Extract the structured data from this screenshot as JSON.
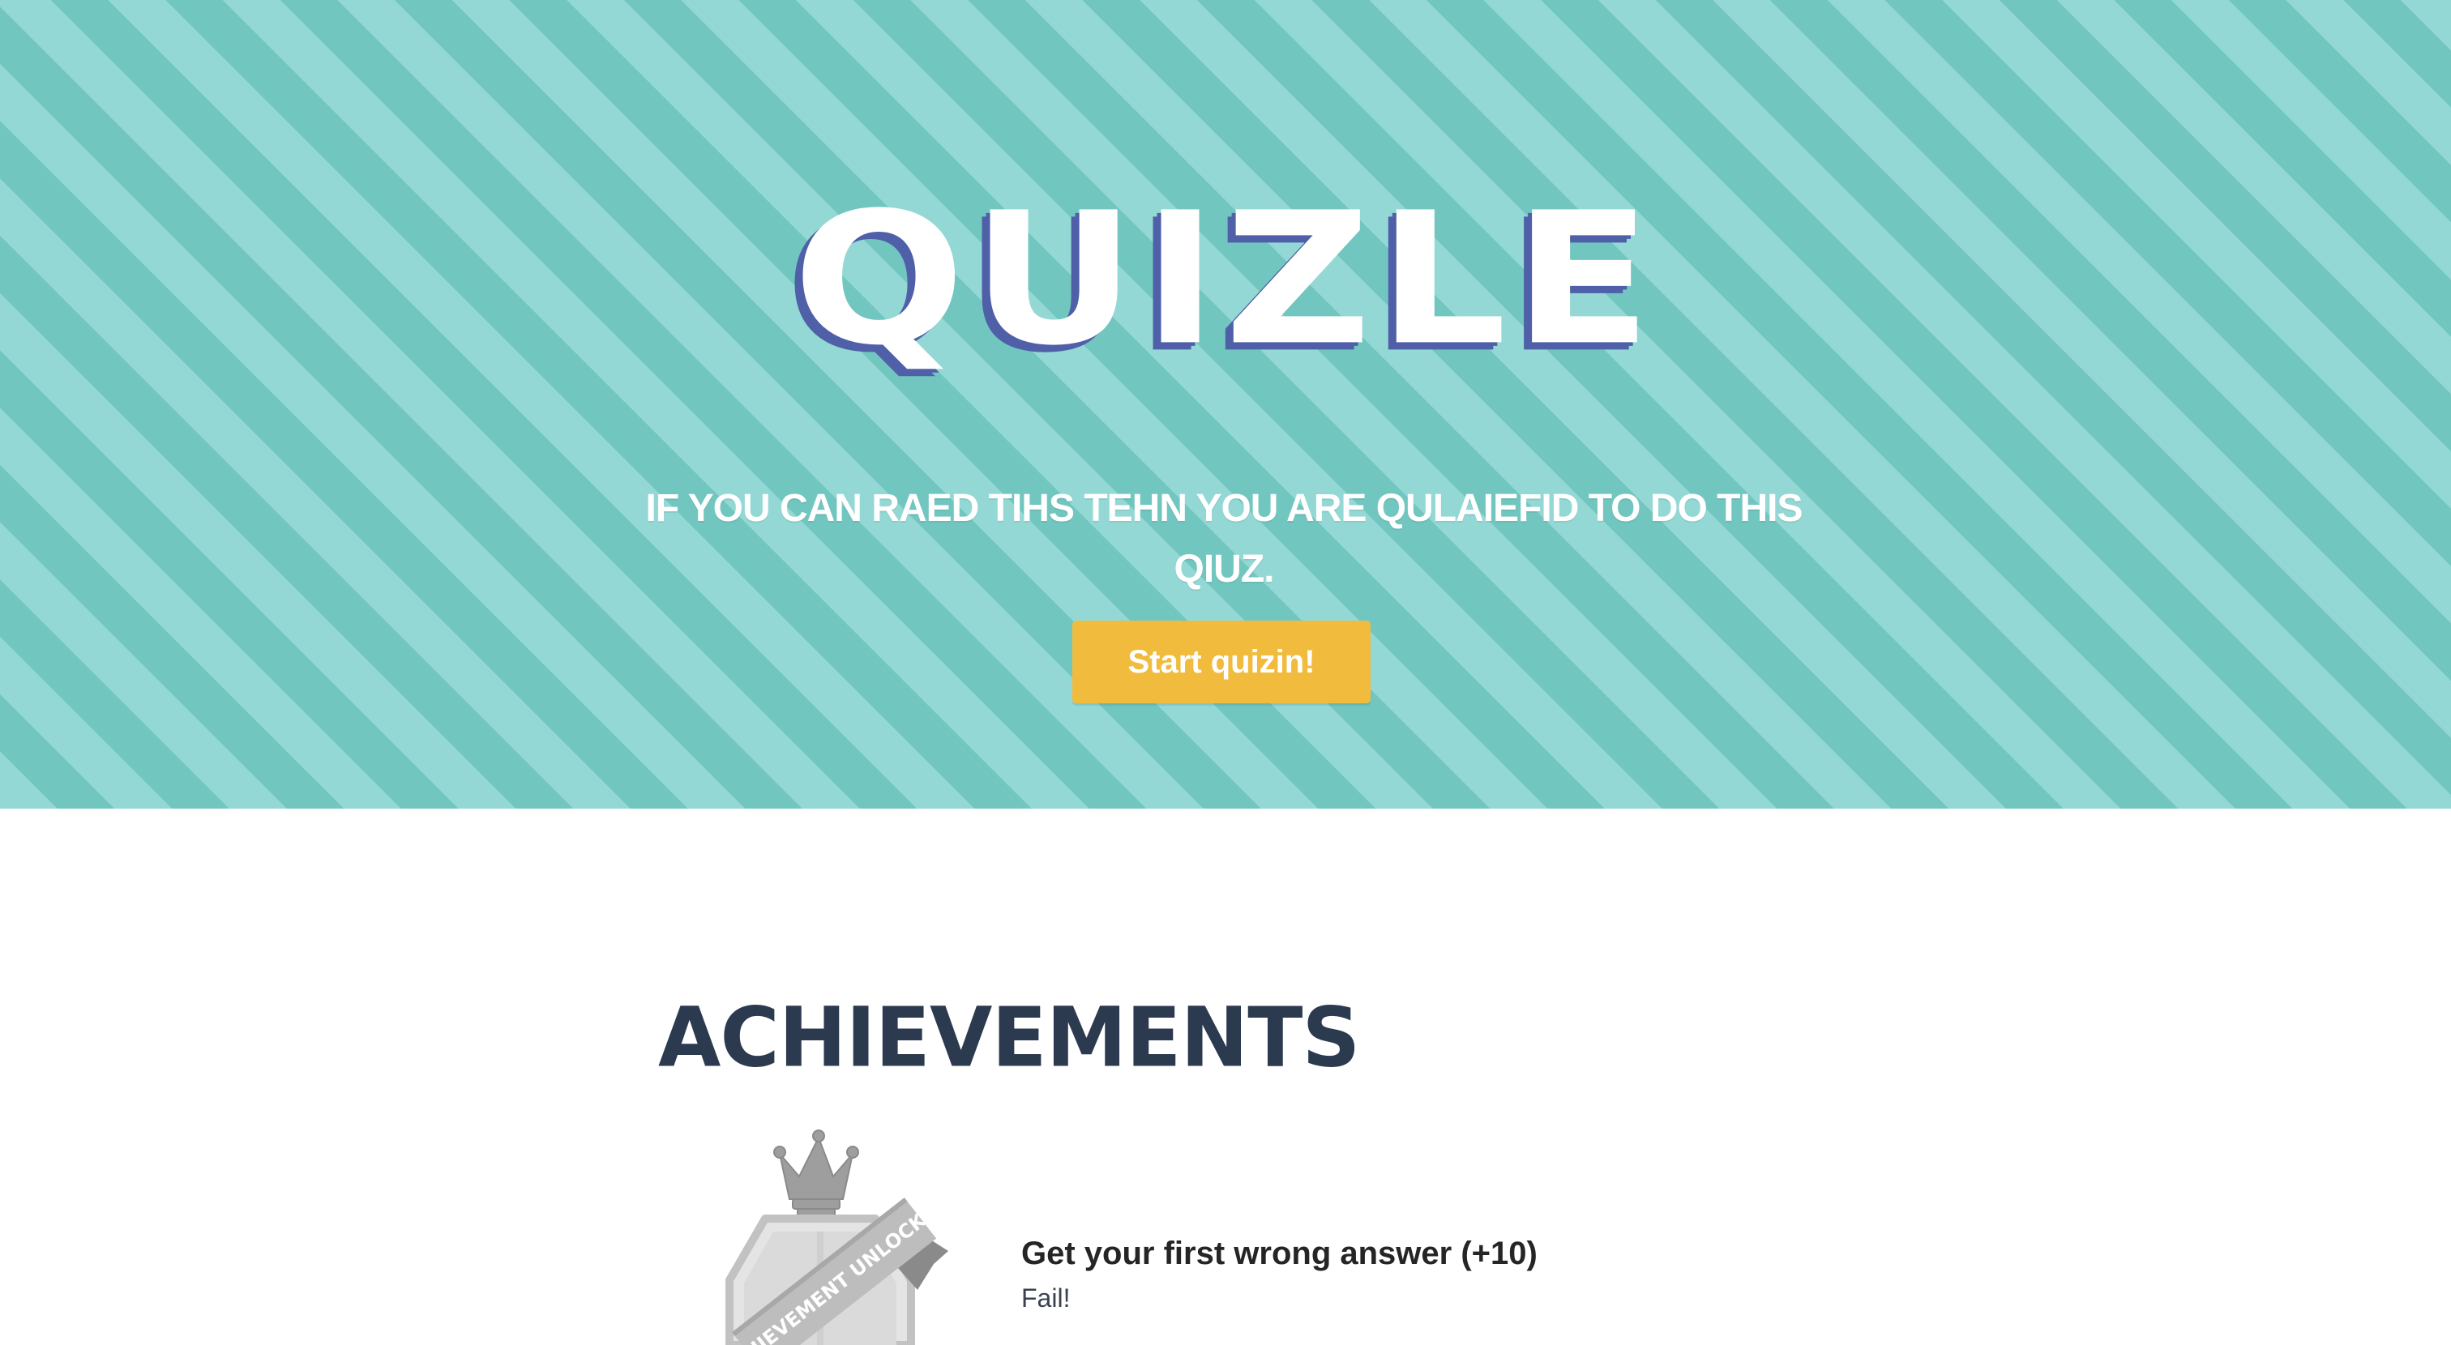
{
  "hero": {
    "logo": "QUIZLE",
    "tagline": "IF YOU CAN RAED TIHS TEHN YOU ARE QULAIEFID TO DO THIS QIUZ.",
    "start_button": "Start quizin!"
  },
  "achievements": {
    "heading": "ACHIEVEMENTS",
    "items": [
      {
        "badge_ribbon": "ACHIEVEMENT UNLOCKED",
        "title": "Get your first wrong answer (+10)",
        "description": "Fail!"
      }
    ]
  },
  "colors": {
    "stripe_light": "#93d8d4",
    "stripe_dark": "#72c6c0",
    "logo_shadow": "#4f5fa8",
    "button": "#f1bc3e",
    "heading": "#2c3a4f"
  }
}
